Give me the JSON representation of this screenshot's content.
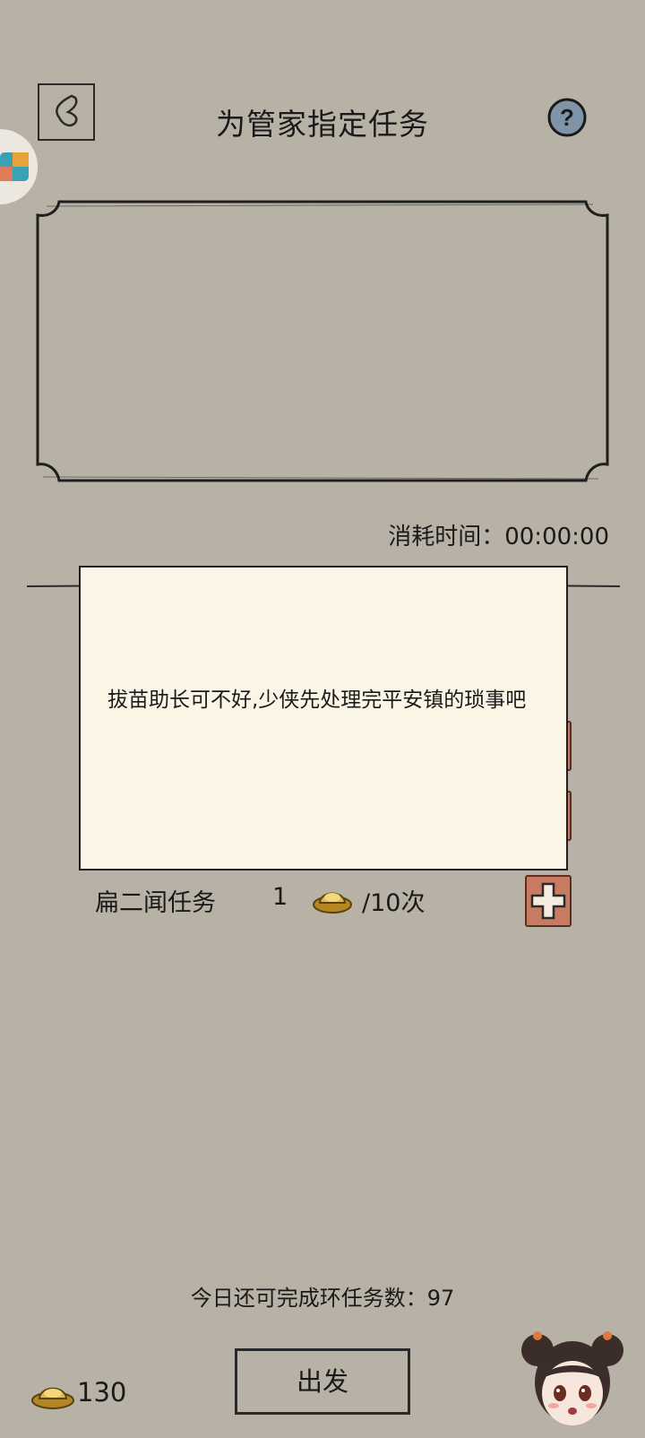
{
  "header": {
    "title": "为管家指定任务",
    "back_icon": "back-arrow-icon",
    "help_icon": "question-mark-icon"
  },
  "timer": {
    "label": "消耗时间：",
    "value": "00:00:00"
  },
  "task": {
    "name": "扁二闻任务",
    "count": "1",
    "limit": "/10次"
  },
  "dialog": {
    "message": "拔苗助长可不好,少侠先处理完平安镇的琐事吧"
  },
  "footer": {
    "remaining_label": "今日还可完成环任务数：",
    "remaining_value": "97",
    "currency_value": "130",
    "depart_label": "出发"
  },
  "colors": {
    "background": "#b8b2a6",
    "dialog": "#fbf5e6",
    "plus_button": "#c87a62",
    "help_button": "#7f94a6",
    "ingot": "#d7ac3c"
  }
}
